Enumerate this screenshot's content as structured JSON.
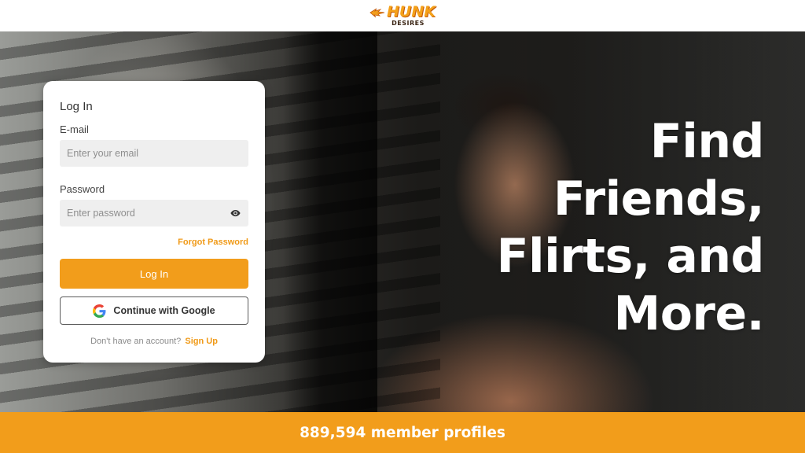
{
  "header": {
    "logo_main": "HUNK",
    "logo_sub": "DESIRES"
  },
  "login": {
    "title": "Log In",
    "email_label": "E-mail",
    "email_placeholder": "Enter your email",
    "password_label": "Password",
    "password_placeholder": "Enter password",
    "forgot_label": "Forgot Password",
    "login_button": "Log In",
    "google_button": "Continue with Google",
    "signup_prompt": "Don't have an account?",
    "signup_link": "Sign Up"
  },
  "hero": {
    "headline_lines": [
      "Find",
      "Friends,",
      "Flirts, and",
      "More."
    ]
  },
  "footer": {
    "member_count_text": "889,594 member profiles"
  },
  "icons": {
    "password_toggle": "eye-icon",
    "google": "google-g-icon",
    "logo_flame": "flame-icon"
  },
  "colors": {
    "accent": "#f29d1b",
    "text_dark": "#333333",
    "input_bg": "#efefef"
  }
}
